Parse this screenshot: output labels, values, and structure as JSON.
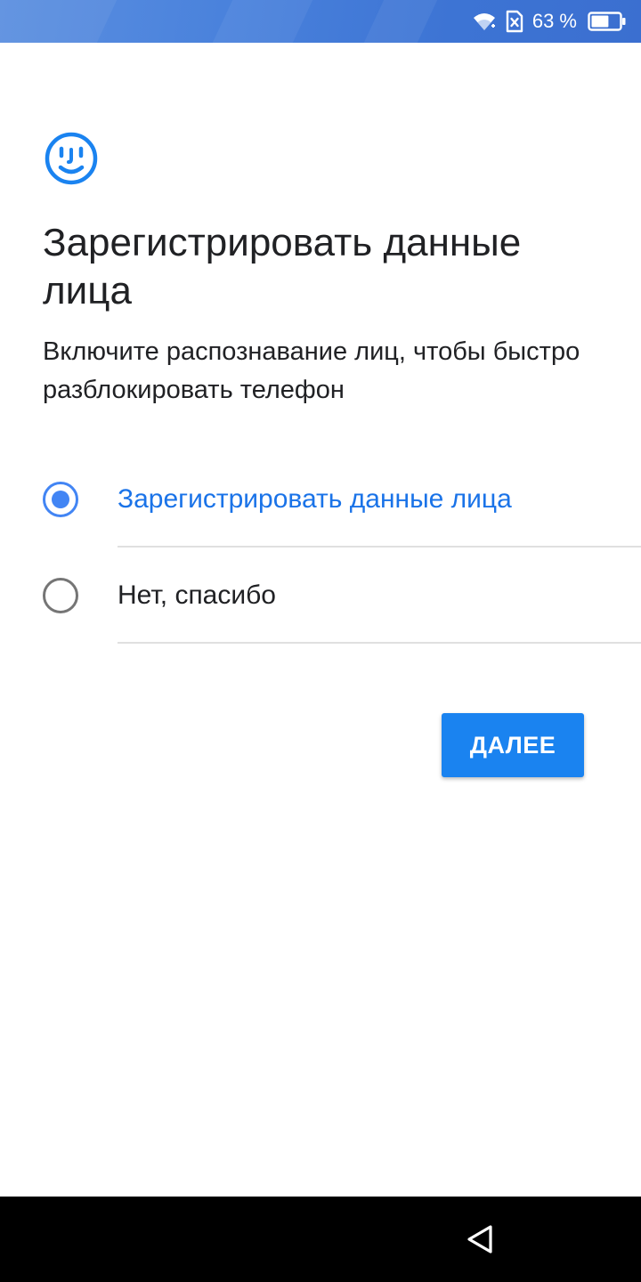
{
  "status_bar": {
    "battery_percent": "63 %",
    "background_color": "#4a82dc",
    "icons": [
      "wifi-icon",
      "sim-missing-icon",
      "battery-icon"
    ],
    "battery_level": 0.63
  },
  "header": {
    "icon": "face-icon",
    "icon_color": "#1a83f0",
    "title": "Зарегистрировать данные лица",
    "subtitle": "Включите распознавание лиц, чтобы быстро разблокировать телефон"
  },
  "options": [
    {
      "label": "Зарегистрировать данные лица",
      "selected": true
    },
    {
      "label": "Нет, спасибо",
      "selected": false
    }
  ],
  "accent_color": "#4285f4",
  "next_button": {
    "label": "ДАЛЕЕ",
    "color": "#1a83f0"
  },
  "nav_bar": {
    "icons": [
      "back-icon"
    ]
  }
}
